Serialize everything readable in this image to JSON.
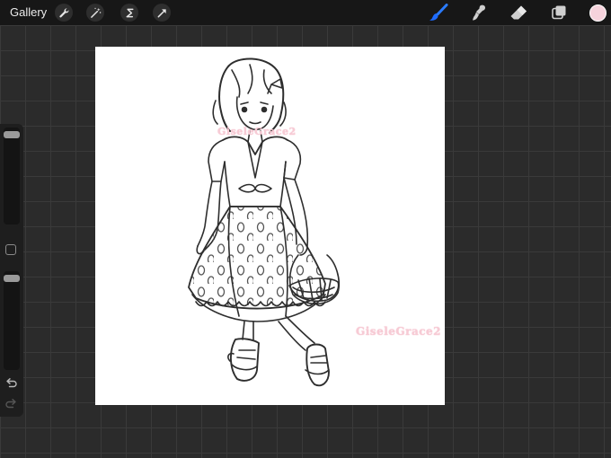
{
  "app": {
    "gallery_label": "Gallery"
  },
  "toolbar_left": {
    "icons": [
      "wrench-icon",
      "magic-wand-icon",
      "selection-icon",
      "transform-arrow-icon"
    ]
  },
  "toolbar_right": {
    "icons": [
      "brush-icon",
      "smudge-icon",
      "eraser-icon",
      "layers-icon"
    ],
    "active_tool": "brush",
    "active_color": "#f6d3dc",
    "accent_color": "#1e6bff"
  },
  "sidebar": {
    "brush_size_level": 0.1,
    "opacity_level": 0.1,
    "icons": [
      "modify-square-icon",
      "undo-icon",
      "redo-icon"
    ]
  },
  "canvas": {
    "background": "#ffffff",
    "watermark_1": "GiseleGrace2",
    "watermark_2": "GiseleGrace2"
  }
}
